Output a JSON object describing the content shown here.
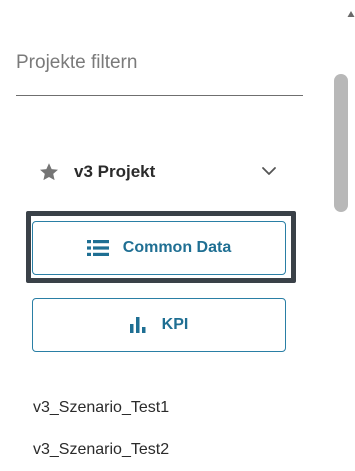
{
  "filter": {
    "placeholder": "Projekte filtern",
    "value": ""
  },
  "project": {
    "title": "v3 Projekt",
    "star_icon": "star-icon",
    "expand_icon": "chevron-down-icon",
    "expanded": true
  },
  "buttons": {
    "common_data": {
      "label": "Common Data",
      "icon": "list-icon",
      "focused": true
    },
    "kpi": {
      "label": "KPI",
      "icon": "bar-chart-icon"
    }
  },
  "scenarios": [
    "v3_Szenario_Test1",
    "v3_Szenario_Test2"
  ],
  "colors": {
    "accent": "#1f6f93",
    "focus_ring": "#3a4148",
    "icon_gray": "#757575",
    "scrollbar": "#b8b8b8"
  }
}
